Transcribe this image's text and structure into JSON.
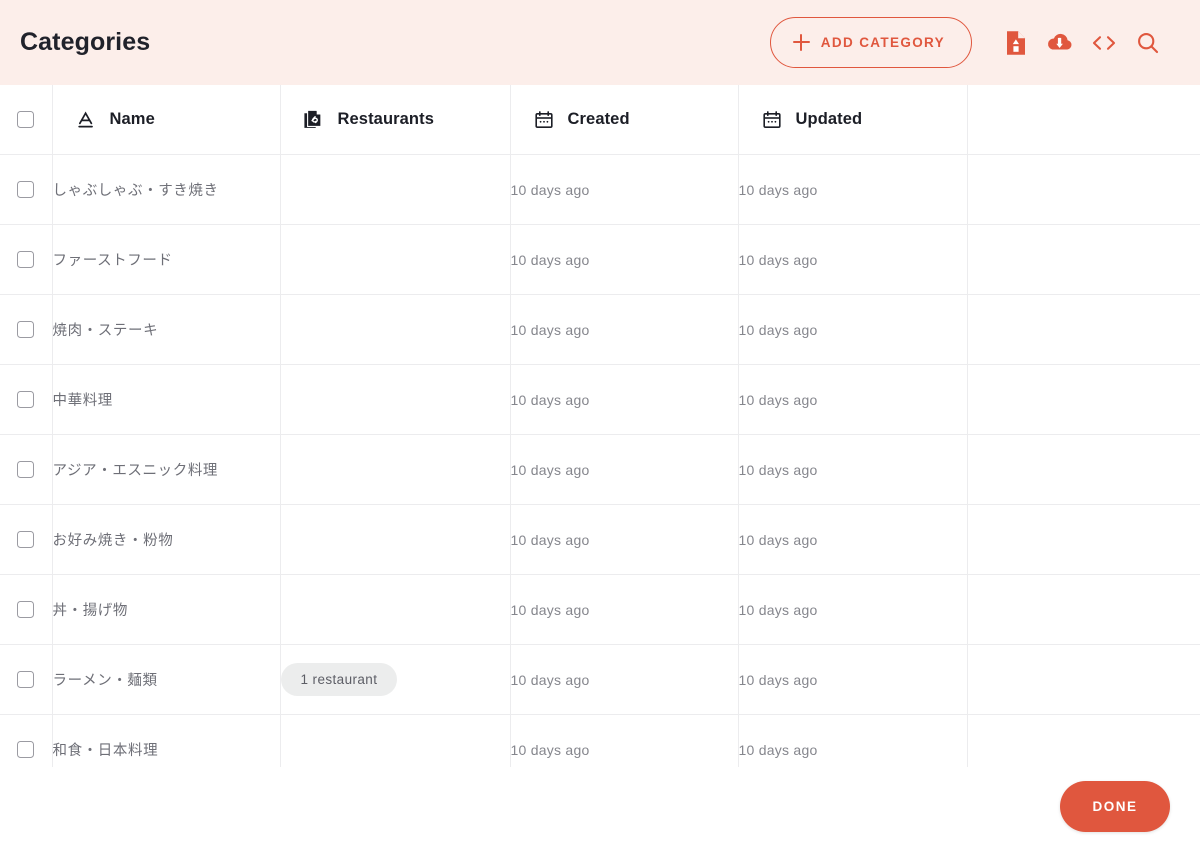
{
  "header": {
    "title": "Categories",
    "add_button": {
      "label": "Add category",
      "icon": "plus-icon"
    },
    "actions": [
      {
        "name": "import-file-button",
        "icon": "file-upload-icon"
      },
      {
        "name": "export-download-button",
        "icon": "cloud-download-icon"
      },
      {
        "name": "api-code-button",
        "icon": "code-brackets-icon"
      },
      {
        "name": "search-button",
        "icon": "search-icon"
      }
    ],
    "accent_color": "#e0573e",
    "background_color": "#fceeea"
  },
  "table": {
    "select_all": {
      "checked": false
    },
    "columns": [
      {
        "key": "name",
        "label": "Name",
        "icon": "text-type-icon"
      },
      {
        "key": "restaurants",
        "label": "Restaurants",
        "icon": "relation-documents-icon"
      },
      {
        "key": "created",
        "label": "Created",
        "icon": "calendar-icon"
      },
      {
        "key": "updated",
        "label": "Updated",
        "icon": "calendar-icon"
      }
    ],
    "rows": [
      {
        "name": "しゃぶしゃぶ・すき焼き",
        "restaurants": "",
        "created": "10 days ago",
        "updated": "10 days ago",
        "checked": false
      },
      {
        "name": "ファーストフード",
        "restaurants": "",
        "created": "10 days ago",
        "updated": "10 days ago",
        "checked": false
      },
      {
        "name": "焼肉・ステーキ",
        "restaurants": "",
        "created": "10 days ago",
        "updated": "10 days ago",
        "checked": false
      },
      {
        "name": "中華料理",
        "restaurants": "",
        "created": "10 days ago",
        "updated": "10 days ago",
        "checked": false
      },
      {
        "name": "アジア・エスニック料理",
        "restaurants": "",
        "created": "10 days ago",
        "updated": "10 days ago",
        "checked": false
      },
      {
        "name": "お好み焼き・粉物",
        "restaurants": "",
        "created": "10 days ago",
        "updated": "10 days ago",
        "checked": false
      },
      {
        "name": "丼・揚げ物",
        "restaurants": "",
        "created": "10 days ago",
        "updated": "10 days ago",
        "checked": false
      },
      {
        "name": "ラーメン・麺類",
        "restaurants": "1 restaurant",
        "created": "10 days ago",
        "updated": "10 days ago",
        "checked": false
      },
      {
        "name": "和食・日本料理",
        "restaurants": "",
        "created": "10 days ago",
        "updated": "10 days ago",
        "checked": false
      }
    ]
  },
  "footer": {
    "done_button": {
      "label": "Done",
      "color": "#e0573e"
    }
  }
}
